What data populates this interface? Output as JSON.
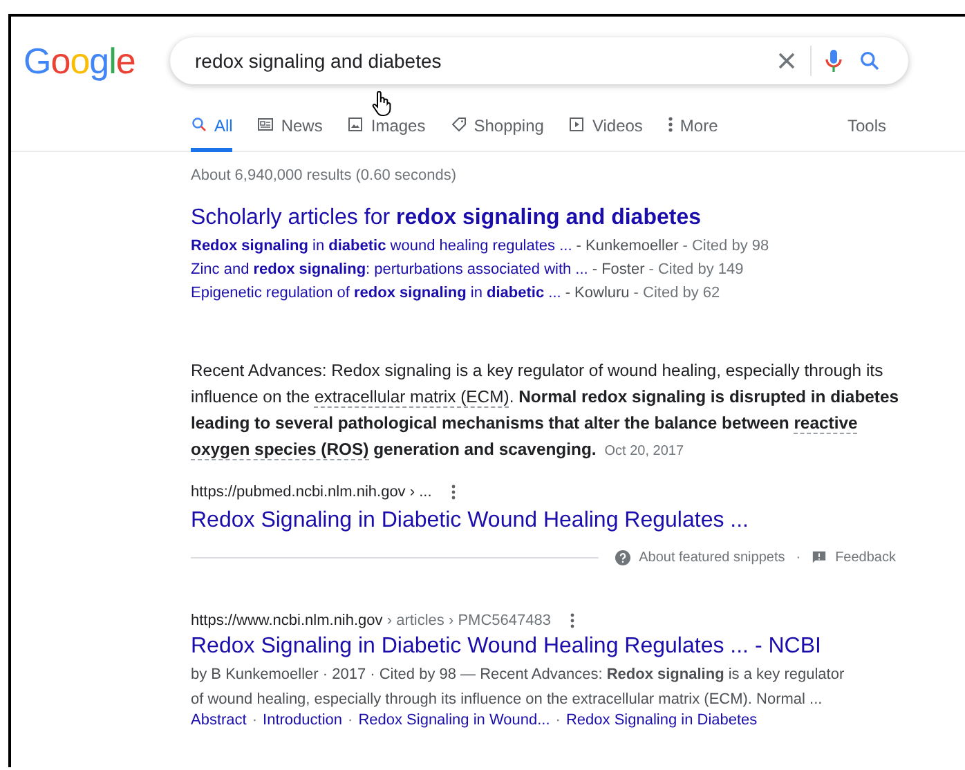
{
  "logo": {
    "letters": [
      {
        "char": "G",
        "color": "#4285f4"
      },
      {
        "char": "o",
        "color": "#ea4335"
      },
      {
        "char": "o",
        "color": "#fbbc05"
      },
      {
        "char": "g",
        "color": "#4285f4"
      },
      {
        "char": "l",
        "color": "#34a853"
      },
      {
        "char": "e",
        "color": "#ea4335"
      }
    ]
  },
  "search": {
    "value": "redox signaling and diabetes"
  },
  "tabs": [
    {
      "label": "All",
      "kind": "search",
      "selected": true
    },
    {
      "label": "News",
      "kind": "news",
      "selected": false
    },
    {
      "label": "Images",
      "kind": "image",
      "selected": false
    },
    {
      "label": "Shopping",
      "kind": "tag",
      "selected": false
    },
    {
      "label": "Videos",
      "kind": "play",
      "selected": false
    },
    {
      "label": "More",
      "kind": "dots",
      "selected": false
    }
  ],
  "tools": "Tools",
  "result_stats": "About 6,940,000 results (0.60 seconds)",
  "scholarly": {
    "title": "Scholarly articles for **redox signaling and diabetes**",
    "articles": [
      {
        "title": "**Redox signaling** in **diabetic** wound healing regulates ...",
        "author": "- Kunkemoeller",
        "cited": "- Cited by 98"
      },
      {
        "title": "Zinc and **redox signaling**: perturbations associated with ...",
        "author": "- Foster",
        "cited": "- Cited by 149"
      },
      {
        "title": "Epigenetic regulation of **redox signaling** in **diabetic** ...",
        "author": "- Kowluru",
        "cited": "- Cited by 62"
      }
    ]
  },
  "featured": {
    "snippet": [
      {
        "text": "Recent Advances: Redox signaling is a key regulator of wound healing, especially through its influence on the ",
        "bold": false,
        "dotted": false
      },
      {
        "text": "extracellular matrix (ECM)",
        "bold": false,
        "dotted": true
      },
      {
        "text": ". ",
        "bold": false,
        "dotted": false
      },
      {
        "text": "Normal redox signaling is disrupted in diabetes leading to several pathological mechanisms that alter the balance between ",
        "bold": true,
        "dotted": false
      },
      {
        "text": "reactive oxygen species (ROS)",
        "bold": true,
        "dotted": true
      },
      {
        "text": " generation and scavenging.",
        "bold": true,
        "dotted": false
      }
    ],
    "date": "Oct 20, 2017",
    "url": "https://pubmed.ncbi.nlm.nih.gov › ...",
    "title": "Redox Signaling in Diabetic Wound Healing Regulates ...",
    "about": "About featured snippets",
    "separator": "·",
    "feedback": "Feedback"
  },
  "results": [
    {
      "url": "https://www.ncbi.nlm.nih.gov",
      "breadcrumb": "› articles › PMC5647483",
      "title": "Redox Signaling in Diabetic Wound Healing Regulates ... - NCBI",
      "description": "by B Kunkemoeller · 2017 · Cited by 98 — Recent Advances: **Redox signaling** is a key regulator of wound healing, especially through its influence on the extracellular matrix (ECM). Normal ...",
      "links": [
        "Abstract",
        "Introduction",
        "Redox Signaling in Wound...",
        "Redox Signaling in Diabetes"
      ],
      "link_separator": "·"
    }
  ]
}
